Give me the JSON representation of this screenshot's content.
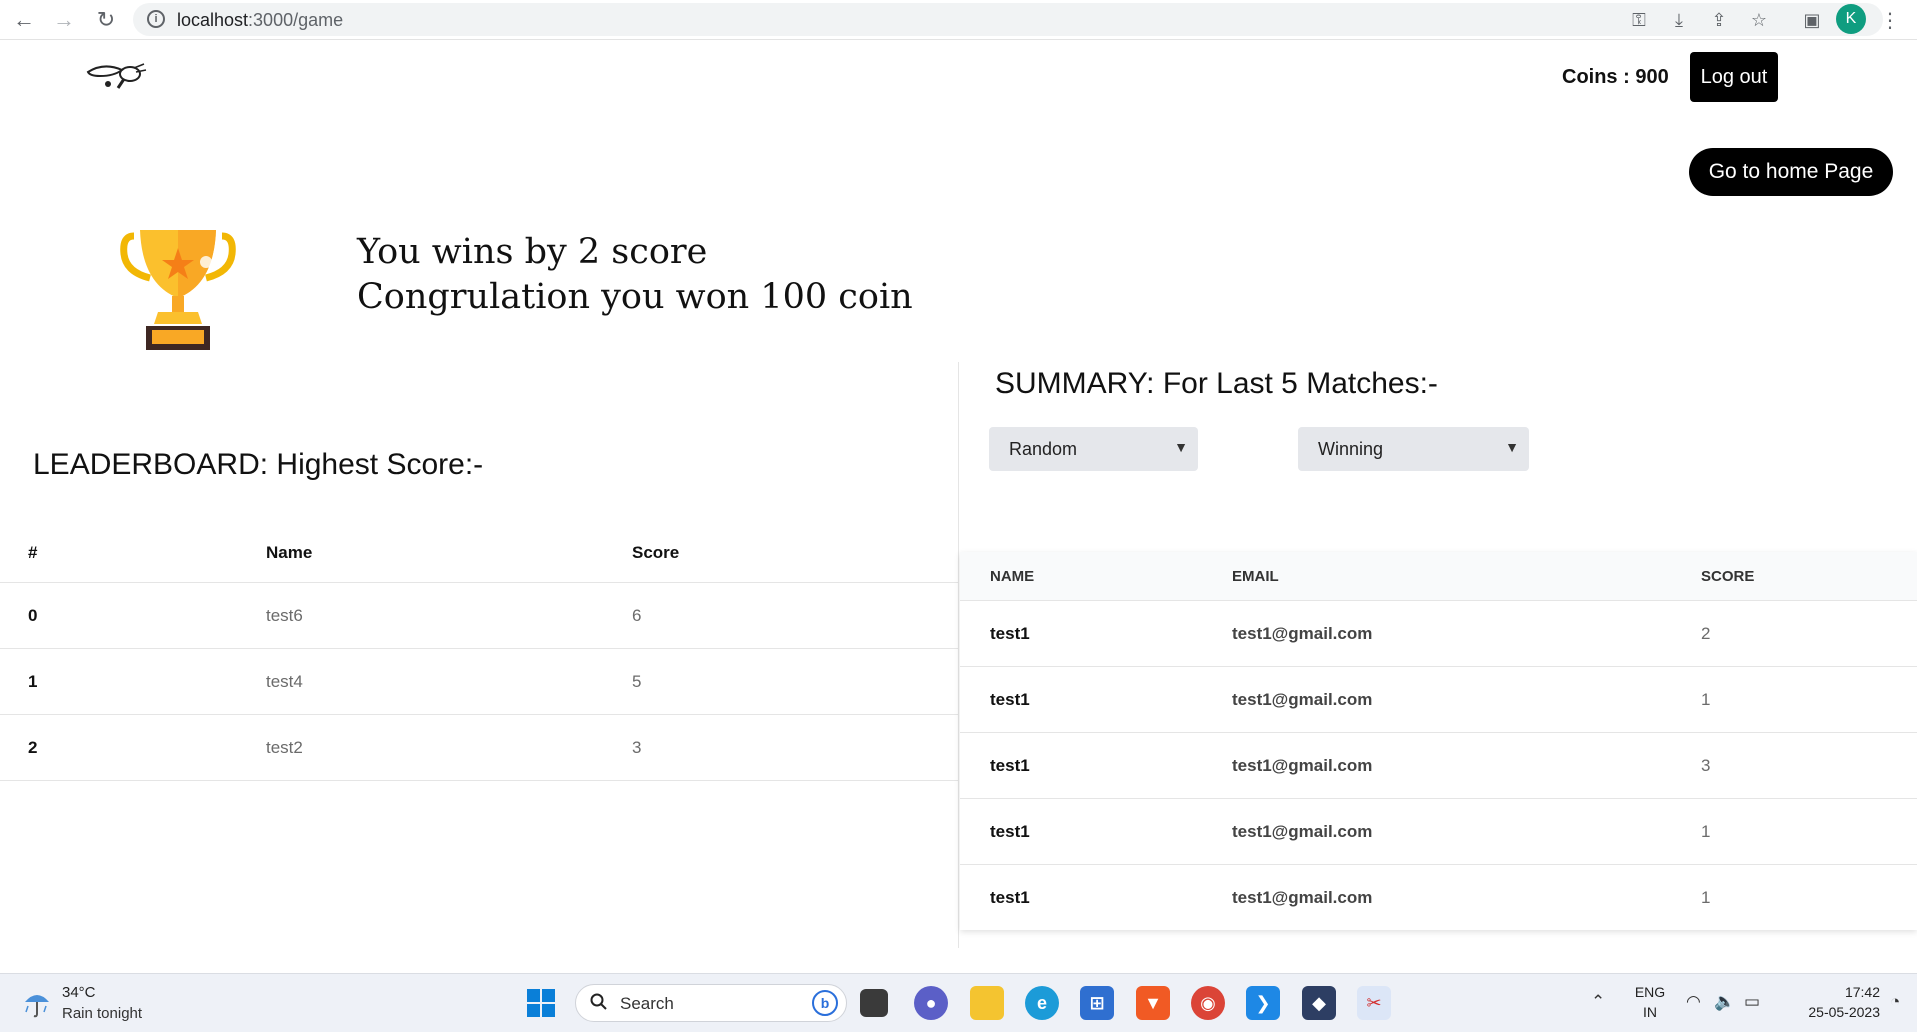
{
  "browser": {
    "url_host": "localhost",
    "url_path": ":3000/game"
  },
  "header": {
    "coins_label": "Coins : 900",
    "logout_label": "Log out",
    "logo_text": "PING PONG"
  },
  "home_button_label": "Go to home Page",
  "result": {
    "line1": "You wins by 2 score",
    "line2": "Congrulation you won 100 coin"
  },
  "leaderboard": {
    "title": "LEADERBOARD: Highest Score:-",
    "columns": [
      "#",
      "Name",
      "Score"
    ],
    "rows": [
      {
        "idx": "0",
        "name": "test6",
        "score": "6"
      },
      {
        "idx": "1",
        "name": "test4",
        "score": "5"
      },
      {
        "idx": "2",
        "name": "test2",
        "score": "3"
      }
    ]
  },
  "summary": {
    "title": "SUMMARY: For Last 5 Matches:-",
    "filter_mode": "Random",
    "filter_result": "Winning",
    "columns": [
      "NAME",
      "EMAIL",
      "SCORE"
    ],
    "rows": [
      {
        "name": "test1",
        "email": "test1@gmail.com",
        "score": "2"
      },
      {
        "name": "test1",
        "email": "test1@gmail.com",
        "score": "1"
      },
      {
        "name": "test1",
        "email": "test1@gmail.com",
        "score": "3"
      },
      {
        "name": "test1",
        "email": "test1@gmail.com",
        "score": "1"
      },
      {
        "name": "test1",
        "email": "test1@gmail.com",
        "score": "1"
      }
    ]
  },
  "taskbar": {
    "weather_temp": "34°C",
    "weather_desc": "Rain tonight",
    "search_label": "Search",
    "lang_line1": "ENG",
    "lang_line2": "IN",
    "time": "17:42",
    "date": "25-05-2023",
    "profile_initial": "K"
  },
  "colors": {
    "primary_button": "#000000",
    "select_bg": "#e5e7eb",
    "avatar": "#0f9d80"
  }
}
